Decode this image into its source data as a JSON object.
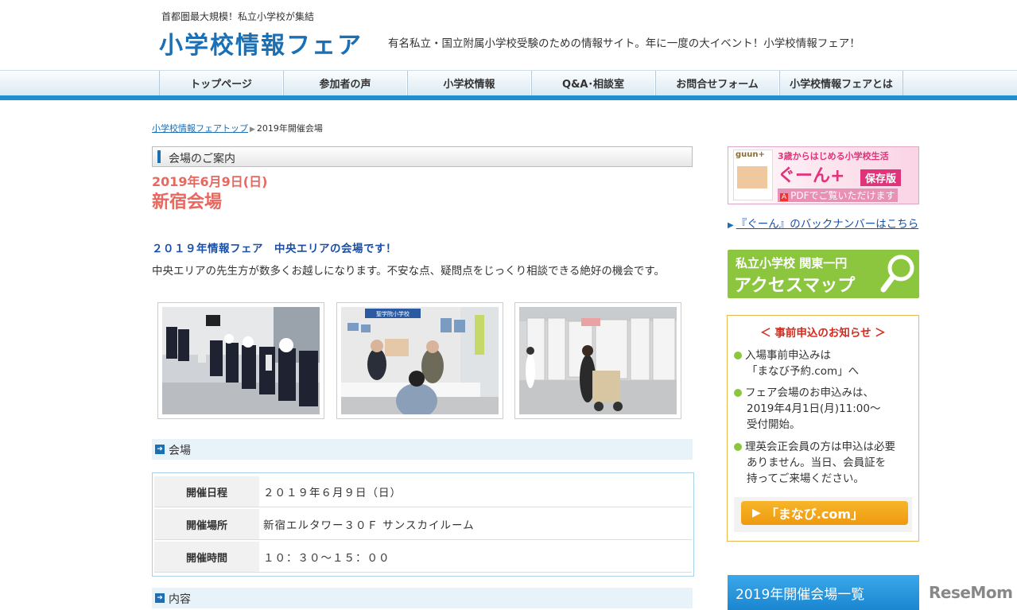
{
  "header": {
    "tagline": "首都圏最大規模！私立小学校が集結",
    "site_title": "小学校情報フェア",
    "site_desc": "有名私立・国立附属小学校受験のための情報サイト。年に一度の大イベント！小学校情報フェア！"
  },
  "nav": {
    "items": [
      {
        "label": "トップページ"
      },
      {
        "label": "参加者の声"
      },
      {
        "label": "小学校情報"
      },
      {
        "label": "Q&A･相談室"
      },
      {
        "label": "お問合せフォーム"
      },
      {
        "label": "小学校情報フェアとは"
      }
    ]
  },
  "breadcrumb": {
    "home": "小学校情報フェアトップ",
    "current": "2019年開催会場"
  },
  "main": {
    "section_title": "会場のご案内",
    "event_date": "2019年6月9日(日)",
    "venue_name": "新宿会場",
    "intro_heading": "２０１９年情報フェア　中央エリアの会場です！",
    "intro_text": "中央エリアの先生方が数多くお越しになります。不安な点、疑問点をじっくり相談できる絶好の機会です。",
    "venue_bar": "会場",
    "table": [
      {
        "label": "開催日程",
        "value": "２０１９年６月９日（日）"
      },
      {
        "label": "開催場所",
        "value": "新宿エルタワー３０Ｆ サンスカイルーム"
      },
      {
        "label": "開催時間",
        "value": "１０：３０～１５：００"
      }
    ],
    "content_bar": "内容",
    "photo_sign": "聖学院小学校"
  },
  "sidebar": {
    "guun_banner": {
      "logo": "guun+",
      "headline": "3歳からはじめる小学校生活",
      "title": "ぐーん+",
      "badge": "保存版",
      "pdf": "PDFでご覧いただけます"
    },
    "backnumber_link": "『ぐーん』のバックナンバーはこちら",
    "access_map": {
      "line1": "私立小学校 関東一円",
      "line2": "アクセスマップ"
    },
    "notice": {
      "title": "＜ 事前申込のお知らせ ＞",
      "items": [
        {
          "l1": "入場事前申込みは",
          "l2": "「まなび予約.com」へ"
        },
        {
          "l1": "フェア会場のお申込みは、",
          "l2": "2019年4月1日(月)11:00～",
          "l3": "受付開始。"
        },
        {
          "l1": "理英会正会員の方は申込は必要",
          "l2": "ありません。当日、会員証を",
          "l3": "持ってご来場ください。"
        }
      ],
      "button": "「まなび.com」"
    },
    "venue_list_head": "2019年開催会場一覧"
  },
  "watermark": "ReseMom",
  "colors": {
    "accent_blue": "#1a6fb5",
    "date_red": "#e8675e",
    "green": "#8cc63f",
    "orange": "#ee9a10"
  }
}
